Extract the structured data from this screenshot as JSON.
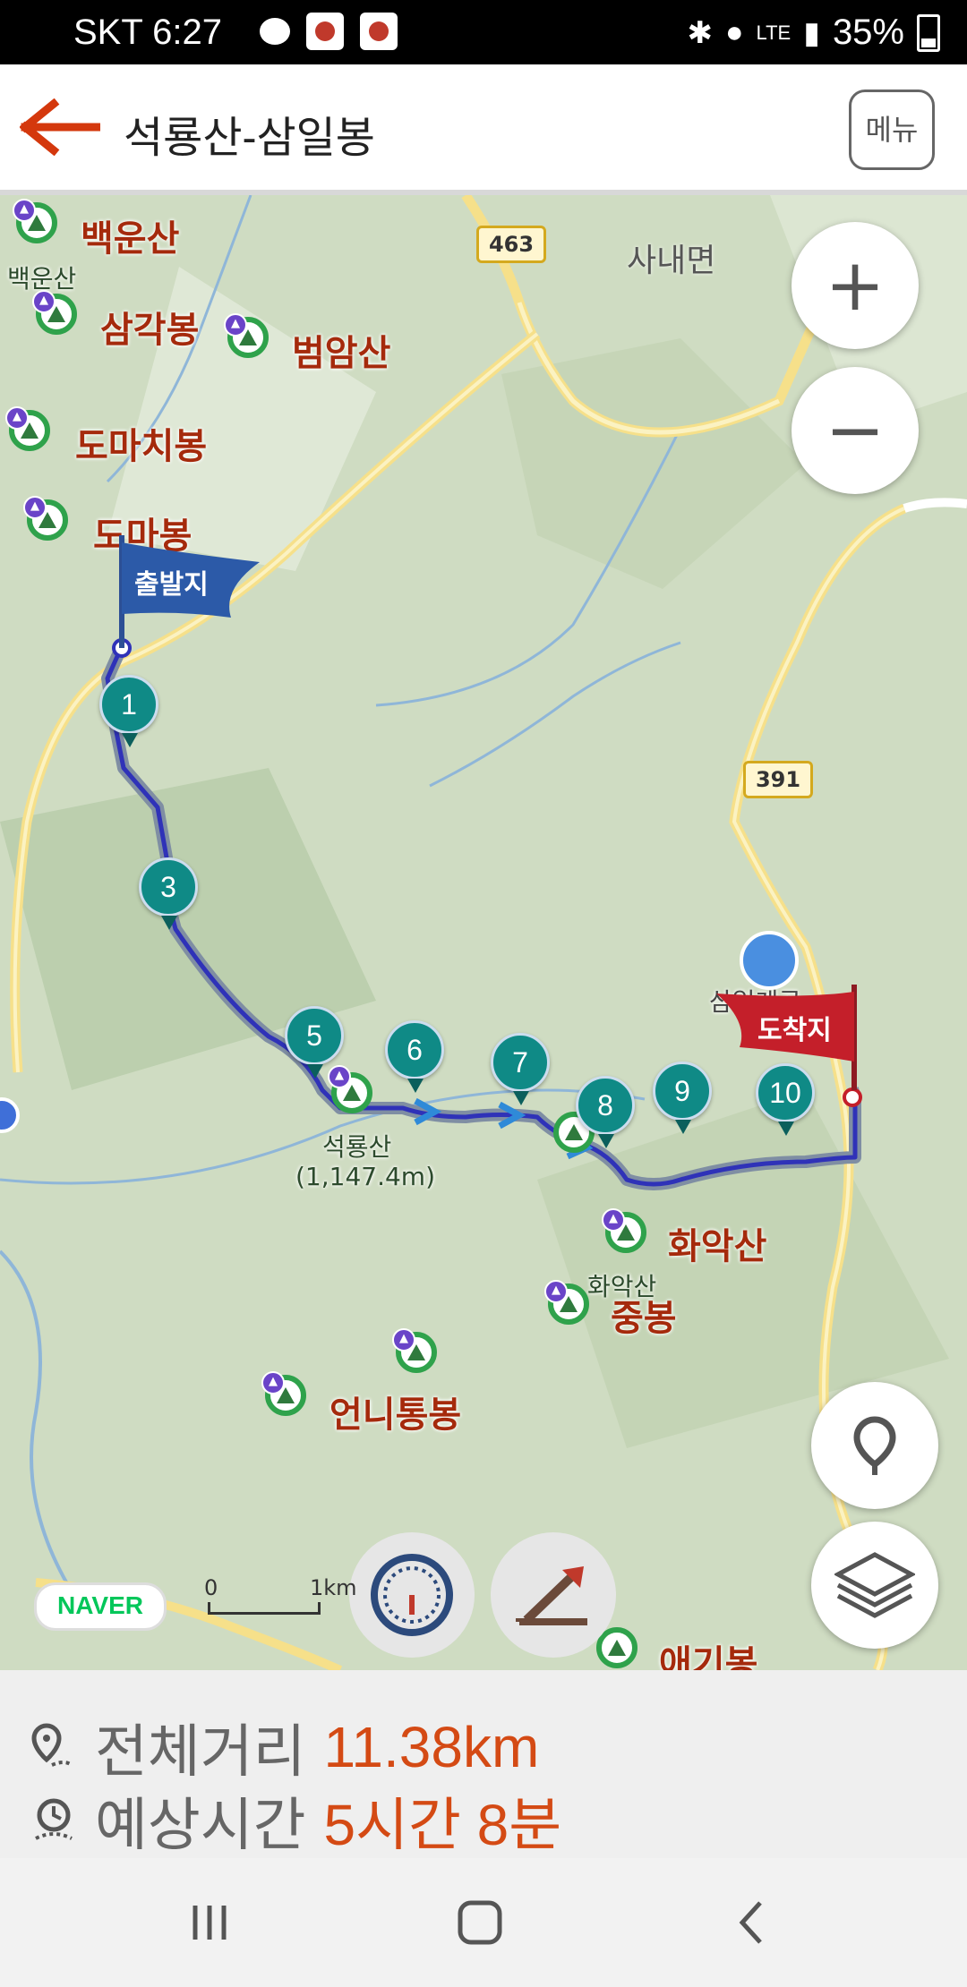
{
  "status_bar": {
    "carrier_time": "SKT 6:27",
    "network": "LTE",
    "battery": "35%"
  },
  "header": {
    "title": "석룡산-삼일봉",
    "menu_label": "메뉴",
    "back_icon": "arrow-left-icon",
    "accent_color": "#d4380d"
  },
  "map": {
    "road_badges": [
      "463",
      "391"
    ],
    "place_labels": {
      "baegunsan": "백운산",
      "baegunsan_small": "백운산",
      "samgakbong": "삼각봉",
      "beomamsan": "범암산",
      "domachibong": "도마치봉",
      "domabong": "도마봉",
      "sanaemyeon": "사내면",
      "hwaaksan": "화악산",
      "hwaaksan_small": "화악산",
      "jungbong": "중봉",
      "eonnitongbong": "언니통봉",
      "aegibong": "애기봉",
      "samilgyegok": "삼일계곡",
      "seokryongsan": "석룡산",
      "seokryongsan_height": "(1,147.4m)"
    },
    "start_flag": "출발지",
    "end_flag": "도착지",
    "waypoints": [
      "1",
      "3",
      "5",
      "6",
      "7",
      "8",
      "9",
      "10"
    ],
    "naver_logo": "NAVER",
    "scale": {
      "start": "0",
      "end": "1km"
    },
    "zoom_in": "+",
    "zoom_out": "−"
  },
  "route_info": {
    "distance_label": "전체거리",
    "distance_value": "11.38km",
    "time_label": "예상시간",
    "time_value": "5시간 8분"
  }
}
